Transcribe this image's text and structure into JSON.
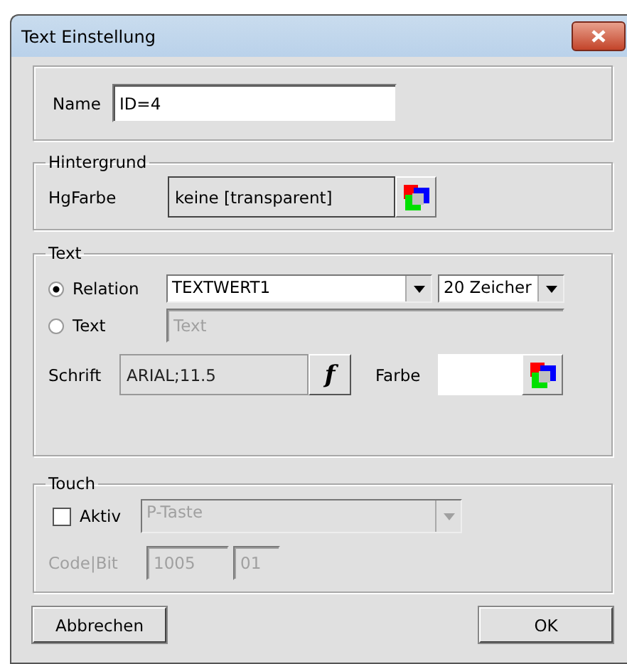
{
  "window": {
    "title": "Text Einstellung"
  },
  "name_group": {
    "label": "Name",
    "value": "ID=4"
  },
  "background_group": {
    "legend": "Hintergrund",
    "label": "HgFarbe",
    "value": "keine [transparent]"
  },
  "text_group": {
    "legend": "Text",
    "options": [
      {
        "label": "Relation",
        "selected": true
      },
      {
        "label": "Text",
        "selected": false
      }
    ],
    "relation_dropdown": "TEXTWERT1",
    "length_dropdown": "20 Zeicher",
    "text_field": {
      "value": "Text",
      "disabled": true
    },
    "font_label": "Schrift",
    "font_value": "ARIAL;11.5",
    "font_button": "f",
    "color_label": "Farbe",
    "color": "#ffffff"
  },
  "touch_group": {
    "legend": "Touch",
    "active": {
      "label": "Aktiv",
      "checked": false
    },
    "key_dropdown": {
      "value": "P-Taste",
      "disabled": true
    },
    "code_label": {
      "text": "Code|Bit",
      "disabled": true
    },
    "code": {
      "value": "1005",
      "disabled": true
    },
    "bit": {
      "value": "01",
      "disabled": true
    }
  },
  "buttons": [
    "Abbrechen",
    "OK"
  ]
}
